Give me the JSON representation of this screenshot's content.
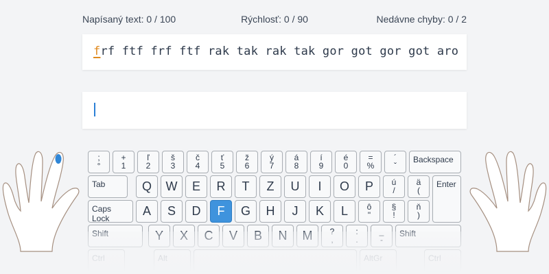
{
  "stats": {
    "typed": "Napísaný text: 0 / 100",
    "speed": "Rýchlosť: 0 / 90",
    "errors": "Nedávne chyby: 0 / 2"
  },
  "lesson": {
    "current_char": "f",
    "remaining_text": "rf ftf frf ftf rak tak rak tak gor got gor got aro"
  },
  "keyboard": {
    "active_key": "F",
    "active_color": "#3f93dd",
    "row1": [
      {
        "top": ";",
        "bot": "°"
      },
      {
        "top": "+",
        "bot": "1"
      },
      {
        "top": "ľ",
        "bot": "2"
      },
      {
        "top": "š",
        "bot": "3"
      },
      {
        "top": "č",
        "bot": "4"
      },
      {
        "top": "ť",
        "bot": "5"
      },
      {
        "top": "ž",
        "bot": "6"
      },
      {
        "top": "ý",
        "bot": "7"
      },
      {
        "top": "á",
        "bot": "8"
      },
      {
        "top": "í",
        "bot": "9"
      },
      {
        "top": "é",
        "bot": "0"
      },
      {
        "top": "=",
        "bot": "%"
      },
      {
        "top": "´",
        "bot": "ˇ"
      }
    ],
    "backspace": "Backspace",
    "tab": "Tab",
    "row2": [
      "Q",
      "W",
      "E",
      "R",
      "T",
      "Z",
      "U",
      "I",
      "O",
      "P"
    ],
    "row2_extra": [
      {
        "top": "ú",
        "bot": "/"
      },
      {
        "top": "ä",
        "bot": "("
      }
    ],
    "enter": "Enter",
    "caps_lock": "Caps Lock",
    "row3": [
      "A",
      "S",
      "D",
      "F",
      "G",
      "H",
      "J",
      "K",
      "L"
    ],
    "row3_extra": [
      {
        "top": "ô",
        "bot": "\""
      },
      {
        "top": "§",
        "bot": "!"
      },
      {
        "top": "ň",
        "bot": ")"
      }
    ],
    "shift_left": "Shift",
    "row4": [
      "Y",
      "X",
      "C",
      "V",
      "B",
      "N",
      "M"
    ],
    "row4_extra": [
      {
        "top": "?",
        "bot": ","
      },
      {
        "top": ":",
        "bot": "."
      },
      {
        "top": "_",
        "bot": "-"
      }
    ],
    "shift_right": "Shift",
    "ctrl": "Ctrl",
    "alt": "Alt",
    "altgr": "AltGr",
    "ctrl_right": "Ctrl"
  }
}
